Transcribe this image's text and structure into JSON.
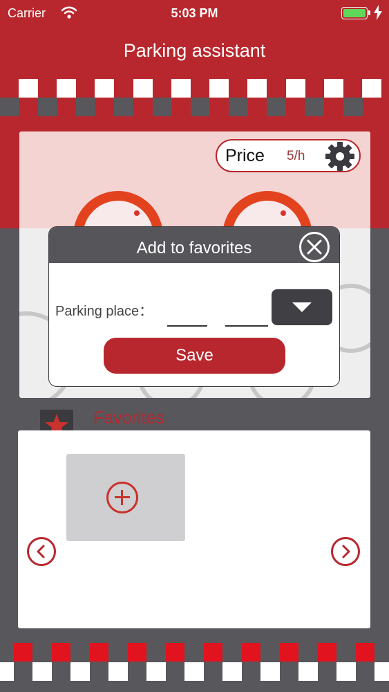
{
  "status_bar": {
    "carrier": "Carrier",
    "time": "5:03 PM",
    "wifi_icon": "wifi-icon",
    "battery_icon": "battery-icon",
    "charging_icon": "bolt-icon"
  },
  "nav": {
    "title": "Parking assistant"
  },
  "price": {
    "label": "Price",
    "value": "5/h",
    "settings_icon": "gear-icon"
  },
  "modal": {
    "title": "Add to favorites",
    "parking_place_label": "Parking place：",
    "save_label": "Save",
    "close_icon": "close-icon",
    "dropdown_icon": "triangle-down-icon"
  },
  "favorites": {
    "title": "Favorites",
    "star_icon": "star-icon",
    "add_icon": "plus-circle-icon",
    "prev_icon": "chevron-left-icon",
    "next_icon": "chevron-right-icon"
  },
  "colors": {
    "brand_red": "#b8272d",
    "dark_gray": "#58575c",
    "dial_orange": "#e8451d",
    "battery_green": "#5fd85a"
  }
}
